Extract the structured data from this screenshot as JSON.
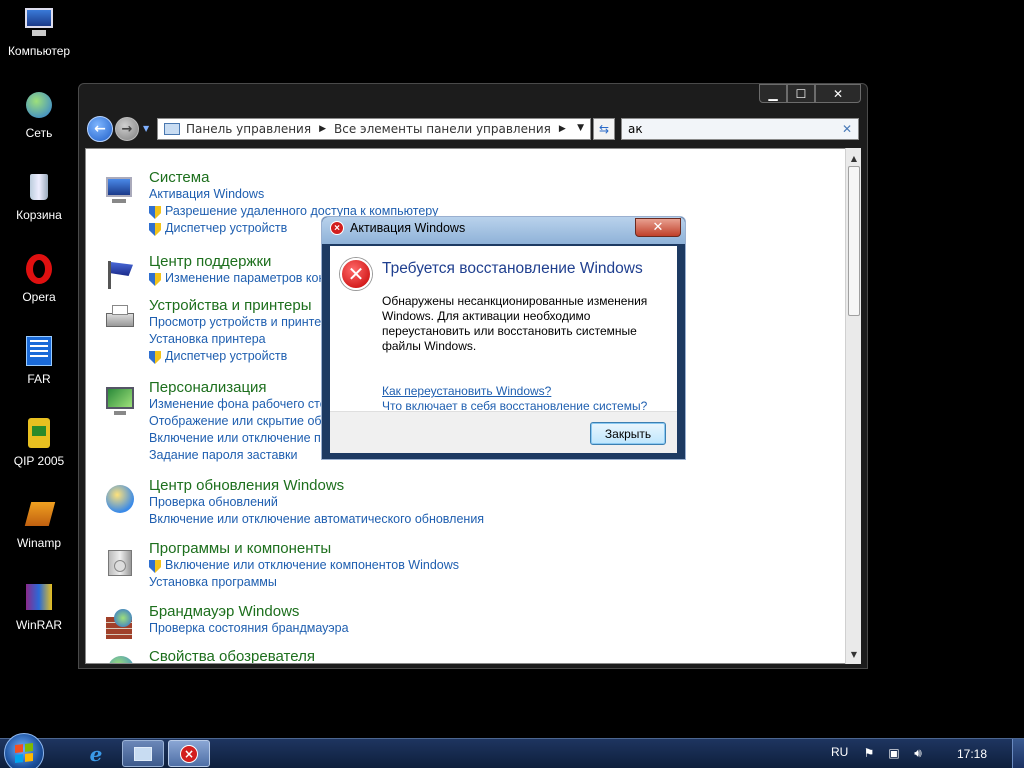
{
  "desktop": {
    "icons": [
      {
        "label": "Компьютер",
        "icon": "computer-icon"
      },
      {
        "label": "Сеть",
        "icon": "network-icon"
      },
      {
        "label": "Корзина",
        "icon": "recycle-bin-icon"
      },
      {
        "label": "Opera",
        "icon": "opera-icon"
      },
      {
        "label": "FAR",
        "icon": "far-icon"
      },
      {
        "label": "QIP 2005",
        "icon": "qip-icon"
      },
      {
        "label": "Winamp",
        "icon": "winamp-icon"
      },
      {
        "label": "WinRAR",
        "icon": "winrar-icon"
      }
    ]
  },
  "explorer": {
    "caption_buttons": {
      "minimize": "▁",
      "maximize": "☐",
      "close": "✕"
    },
    "breadcrumb": [
      "Панель управления",
      "Все элементы панели управления"
    ],
    "search_value": "ак",
    "groups": [
      {
        "title": "Система",
        "icon": "system-icon",
        "links": [
          {
            "text": "Активация Windows",
            "shield": false
          },
          {
            "text": "Разрешение удаленного доступа к компьютеру",
            "shield": true
          },
          {
            "text": "Диспетчер устройств",
            "shield": true
          }
        ]
      },
      {
        "title": "Центр поддержки",
        "icon": "action-center-flag-icon",
        "links": [
          {
            "text": "Изменение параметров контроля учетных записей",
            "shield": true
          }
        ]
      },
      {
        "title": "Устройства и принтеры",
        "icon": "printer-icon",
        "links": [
          {
            "text": "Просмотр устройств и принтеров",
            "shield": false
          },
          {
            "text": "Установка принтера",
            "shield": false
          },
          {
            "text": "Диспетчер устройств",
            "shield": true
          }
        ]
      },
      {
        "title": "Персонализация",
        "icon": "personalization-icon",
        "links": [
          {
            "text": "Изменение фона рабочего стола",
            "shield": false
          },
          {
            "text": "Отображение или скрытие общих значков на рабочем столе",
            "shield": false
          },
          {
            "text": "Включение или отключение прозрачности",
            "shield": false
          },
          {
            "text": "Задание пароля заставки",
            "shield": false
          }
        ]
      },
      {
        "title": "Центр обновления Windows",
        "icon": "windows-update-icon",
        "links": [
          {
            "text": "Проверка обновлений",
            "shield": false
          },
          {
            "text": "Включение или отключение автоматического обновления",
            "shield": false
          }
        ]
      },
      {
        "title": "Программы и компоненты",
        "icon": "programs-icon",
        "links": [
          {
            "text": "Включение или отключение компонентов Windows",
            "shield": true
          },
          {
            "text": "Установка программы",
            "shield": false
          }
        ]
      },
      {
        "title": "Брандмауэр Windows",
        "icon": "firewall-icon",
        "links": [
          {
            "text": "Проверка состояния брандмауэра",
            "shield": false
          }
        ]
      },
      {
        "title": "Свойства обозревателя",
        "icon": "internet-options-icon",
        "links": []
      }
    ]
  },
  "dialog": {
    "title": "Активация Windows",
    "close_glyph": "✕",
    "heading": "Требуется восстановление Windows",
    "body": "Обнаружены несанкционированные изменения Windows. Для активации необходимо переустановить или восстановить системные файлы Windows.",
    "link1": "Как переустановить Windows?",
    "link2": "Что включает в себя восстановление системы?",
    "button": "Закрыть"
  },
  "taskbar": {
    "language": "RU",
    "clock": "17:18"
  },
  "colors": {
    "group_title": "#1d6f1d",
    "link": "#1f5fb0",
    "dialog_heading": "#1f3f8f",
    "error_red": "#c40000"
  }
}
